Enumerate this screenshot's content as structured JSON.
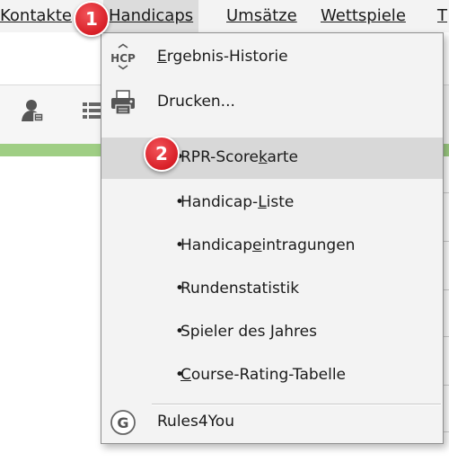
{
  "menubar": {
    "items": [
      {
        "label": "Kontakte",
        "mnemonic_index": 0
      },
      {
        "label": "Handicaps",
        "mnemonic_index": 0
      },
      {
        "label": "Umsätze",
        "mnemonic_index": 0
      },
      {
        "label": "Wettspiele",
        "mnemonic_index": 0
      },
      {
        "label": "T",
        "mnemonic_index": 0
      }
    ],
    "background": "#f3f3f3",
    "active_background": "#dcdcdc"
  },
  "dropdown": {
    "items": [
      {
        "label_before": "",
        "mnemonic": "E",
        "label_after": "rgebnis-Historie",
        "icon": "hcp-icon"
      },
      {
        "label_before": "Drucken...",
        "mnemonic": "",
        "label_after": "",
        "icon": "printer-icon"
      },
      {
        "label_before": "RPR-Score",
        "mnemonic": "k",
        "label_after": "arte",
        "bullet": "•",
        "highlighted": true
      },
      {
        "label_before": "Handicap-",
        "mnemonic": "L",
        "label_after": "iste",
        "bullet": "•"
      },
      {
        "label_before": "Handicap",
        "mnemonic": "e",
        "label_after": "intragungen",
        "bullet": "•"
      },
      {
        "label_before": "Rundenstatistik",
        "mnemonic": "",
        "label_after": "",
        "bullet": "•"
      },
      {
        "label_before": "Spieler des Jahres",
        "mnemonic": "",
        "label_after": "",
        "bullet": "•"
      },
      {
        "label_before": "",
        "mnemonic": "C",
        "label_after": "ourse-Rating-Tabelle",
        "bullet": "•"
      },
      {
        "label_before": "Rules4You",
        "mnemonic": "",
        "label_after": "",
        "icon": "g-circle-icon"
      }
    ],
    "hcp_icon_text": "HCP",
    "g_icon_text": "G"
  },
  "badges": {
    "step1": "1",
    "step2": "2",
    "color": "#d81f27"
  },
  "colors": {
    "green_bar": "#9fce84",
    "highlight": "#d8d8d8"
  }
}
